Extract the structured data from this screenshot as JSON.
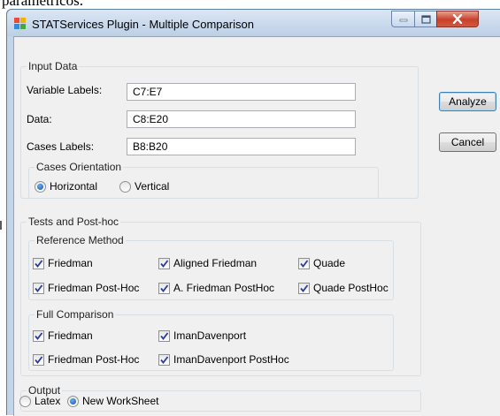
{
  "page": {
    "caption_fragment": "paramétricos."
  },
  "window": {
    "title": "STATServices Plugin - Multiple Comparison",
    "controls": {
      "minimize_glyph": "—",
      "maximize_glyph": "□",
      "close_glyph": "X"
    }
  },
  "input_data": {
    "title": "Input Data",
    "variable_labels": {
      "label": "Variable Labels:",
      "value": "C7:E7"
    },
    "data": {
      "label": "Data:",
      "value": "C8:E20"
    },
    "cases_labels": {
      "label": "Cases Labels:",
      "value": "B8:B20"
    },
    "cases_orientation": {
      "title": "Cases Orientation",
      "options": [
        {
          "label": "Horizontal",
          "selected": true
        },
        {
          "label": "Vertical",
          "selected": false
        }
      ]
    }
  },
  "actions": {
    "analyze_label": "Analyze",
    "cancel_label": "Cancel"
  },
  "tests": {
    "title": "Tests and Post-hoc",
    "reference_method": {
      "title": "Reference Method",
      "items": [
        {
          "label": "Friedman",
          "checked": true
        },
        {
          "label": "Aligned Friedman",
          "checked": true
        },
        {
          "label": "Quade",
          "checked": true
        },
        {
          "label": "Friedman Post-Hoc",
          "checked": true
        },
        {
          "label": "A. Friedman PostHoc",
          "checked": true
        },
        {
          "label": "Quade PostHoc",
          "checked": true
        }
      ]
    },
    "full_comparison": {
      "title": "Full Comparison",
      "items": [
        {
          "label": "Friedman",
          "checked": true
        },
        {
          "label": "ImanDavenport",
          "checked": true
        },
        {
          "label": "Friedman Post-Hoc",
          "checked": true
        },
        {
          "label": "ImanDavenport PostHoc",
          "checked": true
        }
      ]
    }
  },
  "output": {
    "title": "Output",
    "options": [
      {
        "label": "Latex",
        "selected": false
      },
      {
        "label": "New WorkSheet",
        "selected": true
      }
    ]
  },
  "colors": {
    "titlebar": "#c3d5ea",
    "client": "#f0f0f0",
    "close_button": "#c7402b",
    "check_mark": "#2b3c99"
  }
}
